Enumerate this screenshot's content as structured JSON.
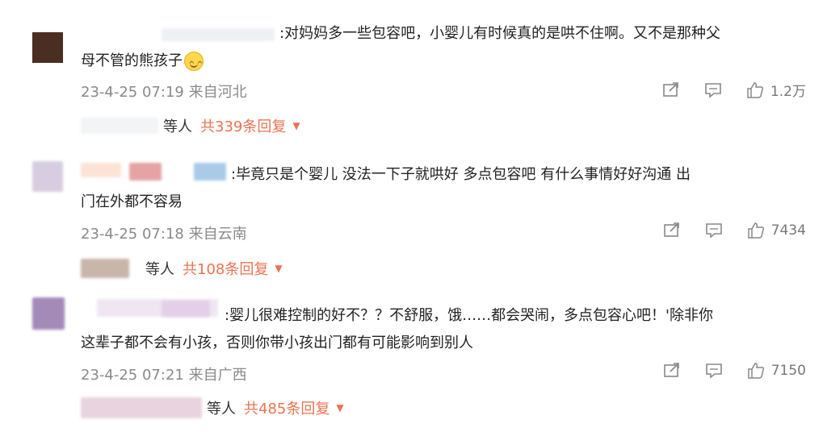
{
  "comments": [
    {
      "text": ":对妈妈多一些包容吧，小婴儿有时候真的是哄不住啊。又不是那种父",
      "text2": "母不管的熊孩子",
      "emoji_icon": "smile-emoji-icon",
      "meta": "23-4-25 07:19 来自河北",
      "likes": "1.2万",
      "reply_names": "等人",
      "reply_count": "共339条回复"
    },
    {
      "text": ":毕竟只是个婴儿  没法一下子就哄好  多点包容吧  有什么事情好好沟通  出",
      "text2": "门在外都不容易",
      "meta": "23-4-25 07:18 来自云南",
      "likes": "7434",
      "reply_names": "等人",
      "reply_count": "共108条回复"
    },
    {
      "text": ":婴儿很难控制的好不？？不舒服，饿……都会哭闹，多点包容心吧！'除非你",
      "text2": "这辈子都不会有小孩，否则你带小孩出门都有可能影响到别人",
      "meta": "23-4-25 07:21 来自广西",
      "likes": "7150",
      "reply_names": "等人",
      "reply_count": "共485条回复"
    }
  ],
  "icons": [
    "share-icon",
    "comment-icon",
    "like-icon",
    "caret-down-icon"
  ],
  "colors": {
    "reply_accent": "#eb7350",
    "meta_gray": "#8a8a8a",
    "text": "#222222"
  }
}
